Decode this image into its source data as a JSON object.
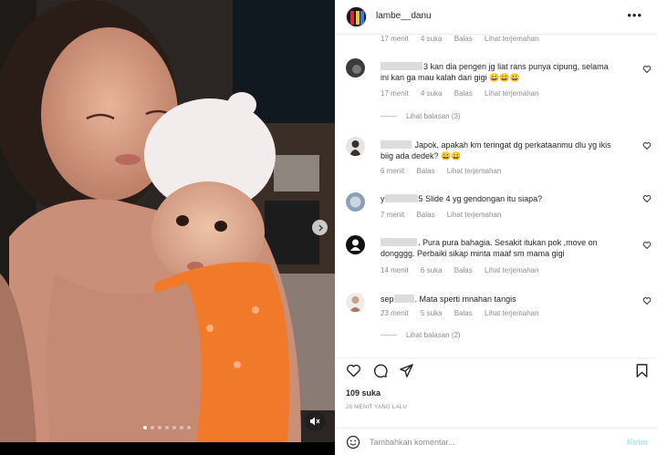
{
  "header": {
    "username": "lambe__danu",
    "more_icon": "more-horizontal-icon"
  },
  "comments": [
    {
      "text": "",
      "time": "17 menit",
      "likes": "4 suka",
      "reply_label": "Balas",
      "translate_label": "Lihat terjemahan"
    },
    {
      "text_line1": "3 kan dia pengen jg liat rans punya cipung, selama",
      "text_line2": "ini kan ga mau kalah dari gigi 😀😀😀",
      "time": "17 menit",
      "likes": "4 suka",
      "reply_label": "Balas",
      "translate_label": "Lihat terjemahan",
      "view_replies": "Lihat balasan (3)"
    },
    {
      "text_line1": "Japok, apakah km teringat dg perkataanmu dlu yg ikis",
      "text_line2": "biig ada dedek? 😀😀",
      "time": "6 menit",
      "reply_label": "Balas",
      "translate_label": "Lihat terjemahan"
    },
    {
      "text_prefix": "y",
      "text_line1": "5 Slide 4 yg gendongan itu siapa?",
      "time": "7 menit",
      "reply_label": "Balas",
      "translate_label": "Lihat terjemahan"
    },
    {
      "text_line1": ". Pura pura bahagia. Sesakit itukan pok ,move on",
      "text_line2": "dongggg. Perbaiki sikap minta maaf sm mama gigi",
      "time": "14 menit",
      "likes": "6 suka",
      "reply_label": "Balas",
      "translate_label": "Lihat terjemahan"
    },
    {
      "text_prefix": "sep",
      "text_line1": ". Mata sperti mnahan tangis",
      "time": "23 menit",
      "likes": "5 suka",
      "reply_label": "Balas",
      "translate_label": "Lihat terjemahan",
      "view_replies": "Lihat balasan (2)"
    }
  ],
  "actions": {
    "likes": "109 suka",
    "posted_ago": "26 MENIT YANG LALU"
  },
  "composer": {
    "placeholder": "Tambahkan komentar...",
    "post_label": "Kirim"
  },
  "media": {
    "carousel_count": 7,
    "carousel_active": 0
  },
  "colors": {
    "link_blue_disabled": "#b2dffc",
    "secondary_text": "#8e8e8e",
    "primary_text": "#262626"
  }
}
